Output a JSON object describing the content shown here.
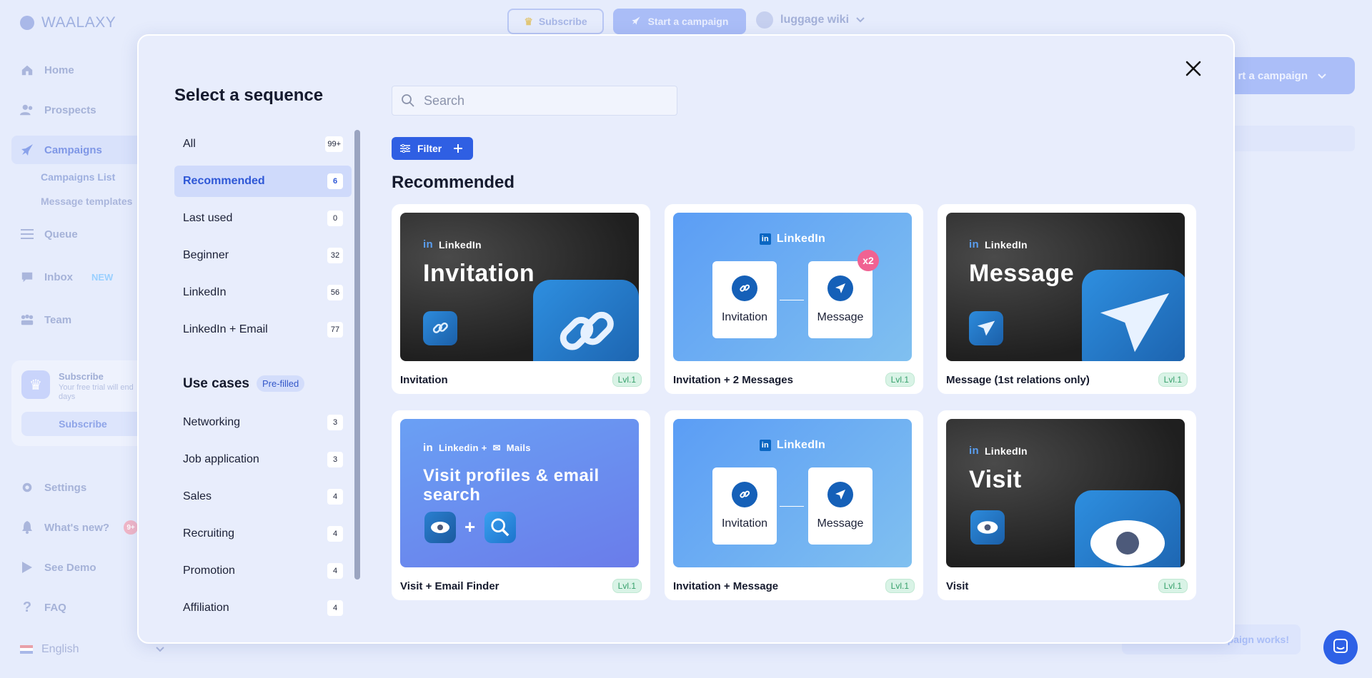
{
  "app": {
    "logo_text": "WAALAXY",
    "top": {
      "subscribe_label": "Subscribe",
      "start_campaign_label": "Start a campaign",
      "user_name": "luggage wiki"
    },
    "sidebar": {
      "items": [
        {
          "label": "Home",
          "icon": "home-icon"
        },
        {
          "label": "Prospects",
          "icon": "users-icon"
        },
        {
          "label": "Campaigns",
          "icon": "rocket-icon"
        },
        {
          "label": "Queue",
          "icon": "queue-icon"
        },
        {
          "label": "Inbox",
          "icon": "chat-icon",
          "badge": "NEW"
        },
        {
          "label": "Team",
          "icon": "team-icon"
        },
        {
          "label": "Settings",
          "icon": "gear-icon"
        },
        {
          "label": "What's new?",
          "icon": "bell-icon",
          "badge": "9+"
        },
        {
          "label": "See Demo",
          "icon": "play-icon"
        },
        {
          "label": "FAQ",
          "icon": "question-icon"
        }
      ],
      "sub_items": [
        "Campaigns List",
        "Message templates"
      ],
      "subscribe_box": {
        "title": "Subscribe",
        "text": "Your free trial will end days",
        "button": "Subscribe"
      },
      "language": "English"
    },
    "right_start_label": "rt a campaign",
    "help_text": "mpaign works!"
  },
  "modal": {
    "title": "Select a sequence",
    "search_placeholder": "Search",
    "filter_label": "Filter",
    "section_title": "Recommended",
    "categories": [
      {
        "label": "All",
        "count": "99+"
      },
      {
        "label": "Recommended",
        "count": "6"
      },
      {
        "label": "Last used",
        "count": "0"
      },
      {
        "label": "Beginner",
        "count": "32"
      },
      {
        "label": "LinkedIn",
        "count": "56"
      },
      {
        "label": "LinkedIn + Email",
        "count": "77"
      }
    ],
    "use_cases_title": "Use cases",
    "use_cases_badge": "Pre-filled",
    "use_cases": [
      {
        "label": "Networking",
        "count": "3"
      },
      {
        "label": "Job application",
        "count": "3"
      },
      {
        "label": "Sales",
        "count": "4"
      },
      {
        "label": "Recruiting",
        "count": "4"
      },
      {
        "label": "Promotion",
        "count": "4"
      },
      {
        "label": "Affiliation",
        "count": "4"
      }
    ],
    "cards": [
      {
        "name": "Invitation",
        "level": "Lvl.1",
        "brand": "LinkedIn",
        "title": "Invitation"
      },
      {
        "name": "Invitation + 2 Messages",
        "level": "Lvl.1",
        "brand": "LinkedIn",
        "step1": "Invitation",
        "step2": "Message",
        "multiplier": "x2"
      },
      {
        "name": "Message (1st relations only)",
        "level": "Lvl.1",
        "brand": "LinkedIn",
        "title": "Message"
      },
      {
        "name": "Visit + Email Finder",
        "level": "Lvl.1",
        "brand": "Linkedin + ",
        "brand2": "Mails",
        "title": "Visit profiles & email search"
      },
      {
        "name": "Invitation + Message",
        "level": "Lvl.1",
        "brand": "LinkedIn",
        "step1": "Invitation",
        "step2": "Message"
      },
      {
        "name": "Visit",
        "level": "Lvl.1",
        "brand": "LinkedIn",
        "title": "Visit"
      }
    ]
  },
  "colors": {
    "accent": "#2f5fe3",
    "level_green": "#36a06b",
    "badge_pink": "#f06292"
  }
}
